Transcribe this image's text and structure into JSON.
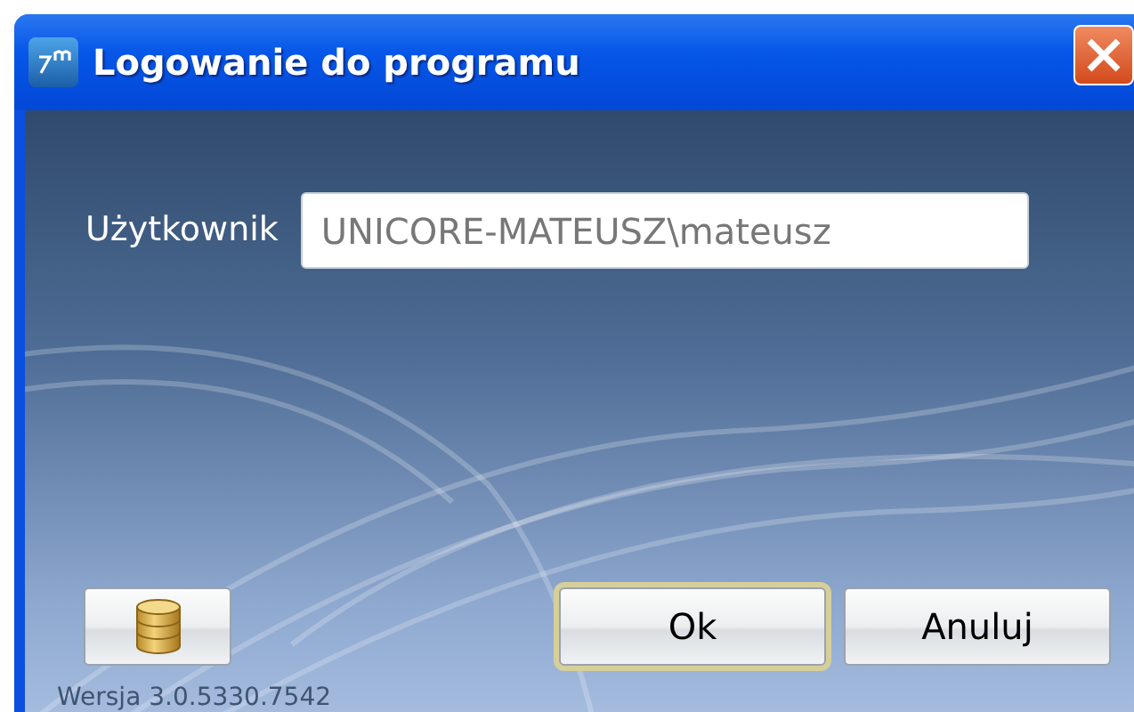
{
  "window": {
    "title": "Logowanie do programu"
  },
  "user": {
    "label": "Użytkownik",
    "value": "UNICORE-MATEUSZ\\mateusz",
    "disabled": true
  },
  "buttons": [
    {
      "kind": "database",
      "focused": false
    },
    {
      "kind": "text",
      "label": "Ok",
      "focused": true
    },
    {
      "kind": "text",
      "label": "Anuluj",
      "focused": false
    }
  ],
  "version": "Wersja 3.0.5330.7542"
}
